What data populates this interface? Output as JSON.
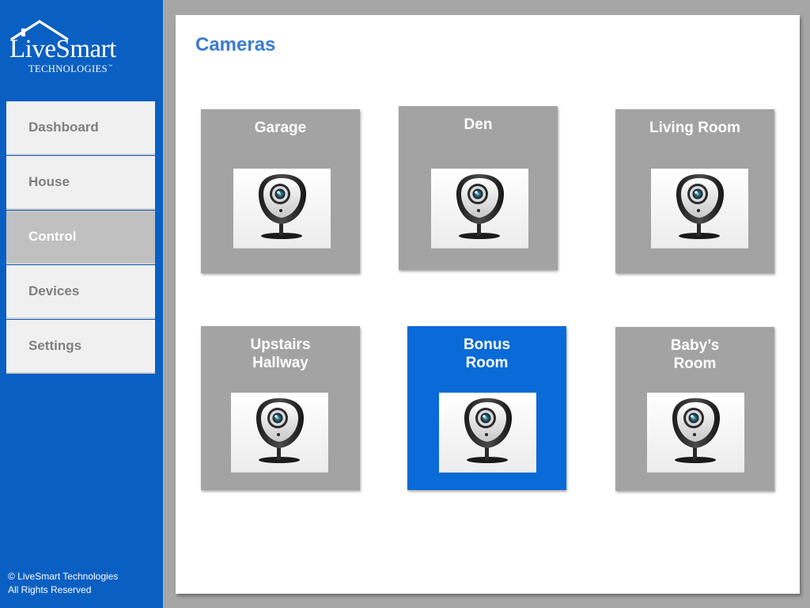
{
  "brand": {
    "name": "LiveSmart",
    "tagline": "TECHNOLOGIES",
    "trademark": "™"
  },
  "nav": {
    "items": [
      {
        "label": "Dashboard",
        "active": false
      },
      {
        "label": "House",
        "active": false
      },
      {
        "label": "Control",
        "active": true
      },
      {
        "label": "Devices",
        "active": false
      },
      {
        "label": "Settings",
        "active": false
      }
    ]
  },
  "footer": {
    "copyright": "© LiveSmart Technologies",
    "rights": "All Rights Reserved"
  },
  "page": {
    "title": "Cameras"
  },
  "cameras": [
    {
      "label": "Garage",
      "selected": false,
      "icon": "webcam-icon"
    },
    {
      "label": "Den",
      "selected": false,
      "icon": "webcam-icon"
    },
    {
      "label": "Living Room",
      "selected": false,
      "icon": "webcam-icon"
    },
    {
      "label": "Upstairs\nHallway",
      "selected": false,
      "icon": "webcam-icon"
    },
    {
      "label": "Bonus\nRoom",
      "selected": true,
      "icon": "webcam-icon"
    },
    {
      "label": "Baby’s\nRoom",
      "selected": false,
      "icon": "webcam-icon"
    }
  ],
  "colors": {
    "sidebar": "#0a5fc2",
    "accent": "#3b7bd0",
    "selected_tile": "#0a6ad8",
    "tile": "#a3a3a3"
  }
}
